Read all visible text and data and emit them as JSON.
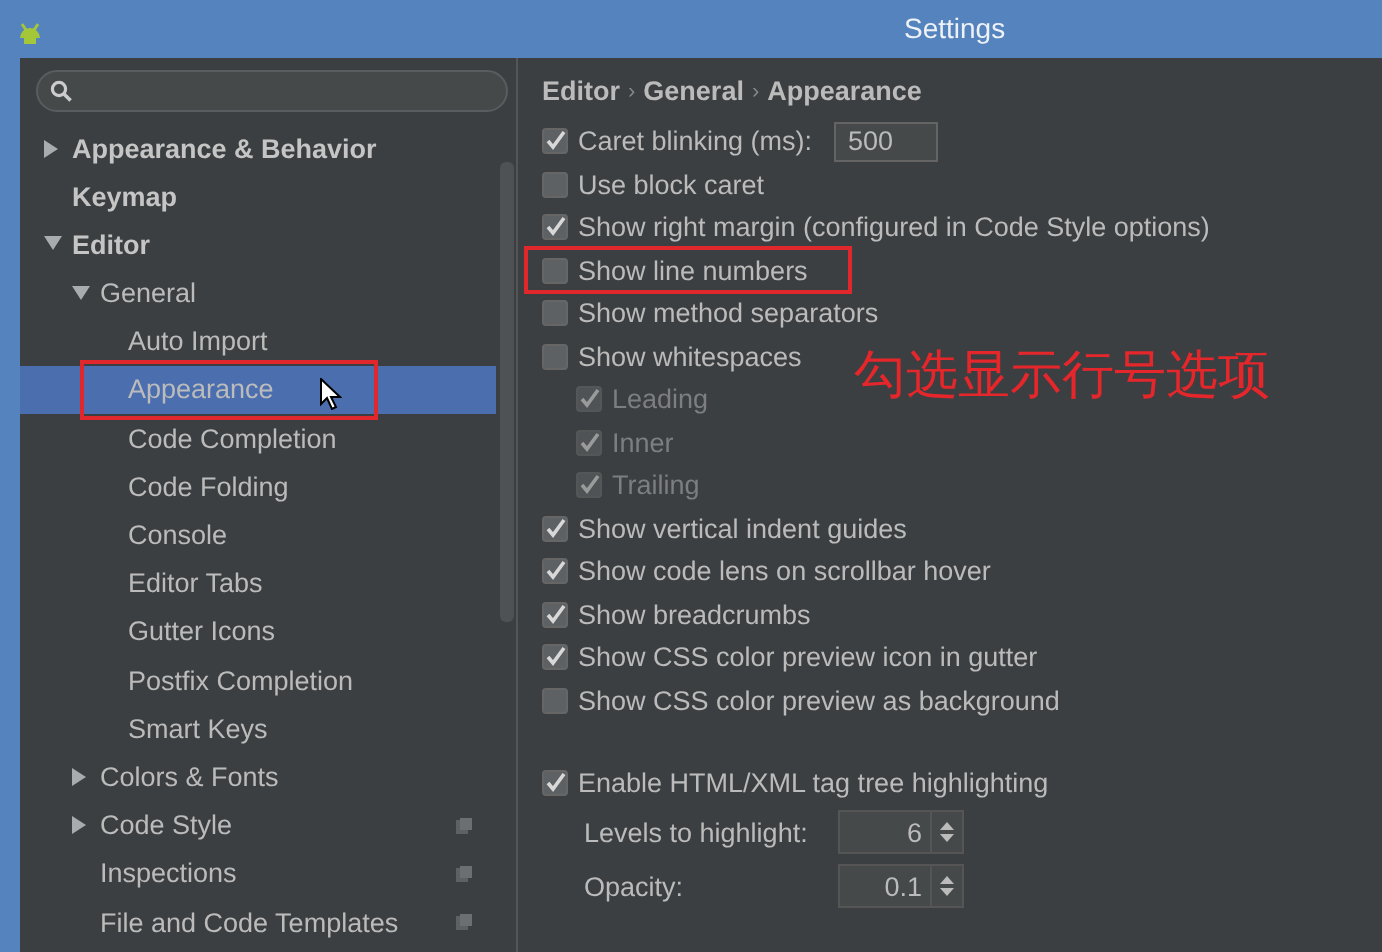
{
  "window": {
    "title": "Settings"
  },
  "sidebar": {
    "tree": [
      {
        "label": "Appearance & Behavior",
        "expanded": false,
        "selected": false
      },
      {
        "label": "Keymap",
        "selected": false
      },
      {
        "label": "Editor",
        "expanded": true,
        "selected": false,
        "children": [
          {
            "label": "General",
            "expanded": true,
            "selected": false,
            "children": [
              {
                "label": "Auto Import",
                "selected": false
              },
              {
                "label": "Appearance",
                "selected": true,
                "highlighted": true,
                "cursor": true
              },
              {
                "label": "Code Completion",
                "selected": false
              },
              {
                "label": "Code Folding",
                "selected": false
              },
              {
                "label": "Console",
                "selected": false
              },
              {
                "label": "Editor Tabs",
                "selected": false
              },
              {
                "label": "Gutter Icons",
                "selected": false
              },
              {
                "label": "Postfix Completion",
                "selected": false
              },
              {
                "label": "Smart Keys",
                "selected": false
              }
            ]
          },
          {
            "label": "Colors & Fonts",
            "expanded": false,
            "selected": false
          },
          {
            "label": "Code Style",
            "expanded": false,
            "selected": false,
            "project_icon": true
          },
          {
            "label": "Inspections",
            "selected": false,
            "project_icon": true
          },
          {
            "label": "File and Code Templates",
            "selected": false,
            "project_icon": true
          }
        ]
      }
    ]
  },
  "breadcrumb": {
    "separator": "›",
    "items": [
      "Editor",
      "General",
      "Appearance"
    ]
  },
  "options": [
    {
      "label": "Caret blinking (ms):",
      "checked": true,
      "value": "500"
    },
    {
      "label": "Use block caret",
      "checked": false
    },
    {
      "label": "Show right margin (configured in Code Style options)",
      "checked": true
    },
    {
      "label": "Show line numbers",
      "checked": false,
      "highlighted": true
    },
    {
      "label": "Show method separators",
      "checked": false
    },
    {
      "label": "Show whitespaces",
      "checked": false,
      "children": [
        {
          "label": "Leading",
          "checked": true,
          "disabled": true
        },
        {
          "label": "Inner",
          "checked": true,
          "disabled": true
        },
        {
          "label": "Trailing",
          "checked": true,
          "disabled": true
        }
      ]
    },
    {
      "label": "Show vertical indent guides",
      "checked": true
    },
    {
      "label": "Show code lens on scrollbar hover",
      "checked": true
    },
    {
      "label": "Show breadcrumbs",
      "checked": true
    },
    {
      "label": "Show CSS color preview icon in gutter",
      "checked": true
    },
    {
      "label": "Show CSS color preview as background",
      "checked": false
    }
  ],
  "tag_highlighting": {
    "label": "Enable HTML/XML tag tree highlighting",
    "checked": true,
    "spinners": [
      {
        "label": "Levels to highlight:",
        "value": "6"
      },
      {
        "label": "Opacity:",
        "value": "0.1"
      }
    ]
  },
  "annotation": {
    "text": "勾选显示行号选项"
  }
}
